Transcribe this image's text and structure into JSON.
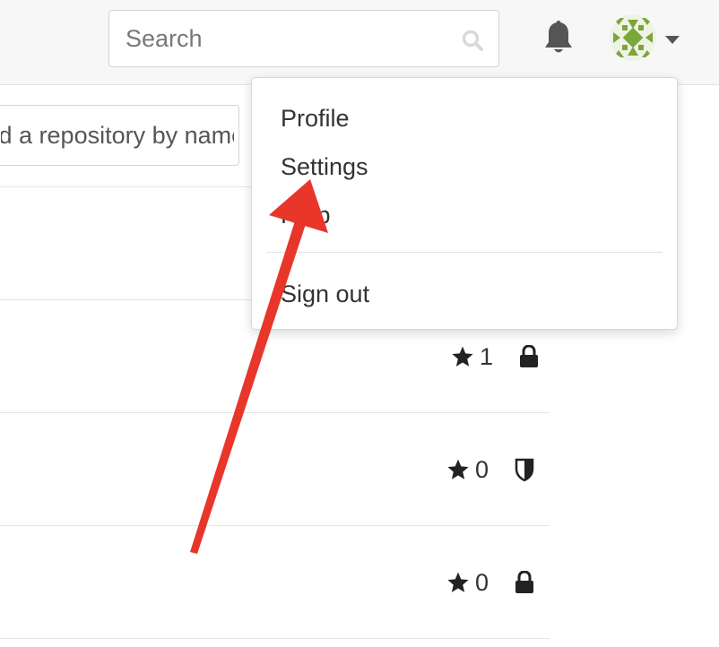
{
  "header": {
    "search_placeholder": "Search",
    "icons": {
      "search": "magnifier-icon",
      "notifications": "bell-icon",
      "avatar": "identicon-avatar",
      "dropdown": "caret-down-icon"
    }
  },
  "filter": {
    "placeholder": "Find a repository by name..."
  },
  "repos": [
    {
      "stars": "1",
      "visibility": "private"
    },
    {
      "stars": "0",
      "visibility": "shield"
    },
    {
      "stars": "0",
      "visibility": "private"
    }
  ],
  "user_menu": {
    "items": [
      {
        "label": "Profile"
      },
      {
        "label": "Settings"
      },
      {
        "label": "Help"
      },
      {
        "label": "Sign out"
      }
    ]
  },
  "annotation": {
    "type": "arrow",
    "color": "#e8362a",
    "points_to": "Settings"
  },
  "colors": {
    "topbar": "#f7f7f7",
    "text": "#333333",
    "avatar_green": "#7aa63a"
  }
}
